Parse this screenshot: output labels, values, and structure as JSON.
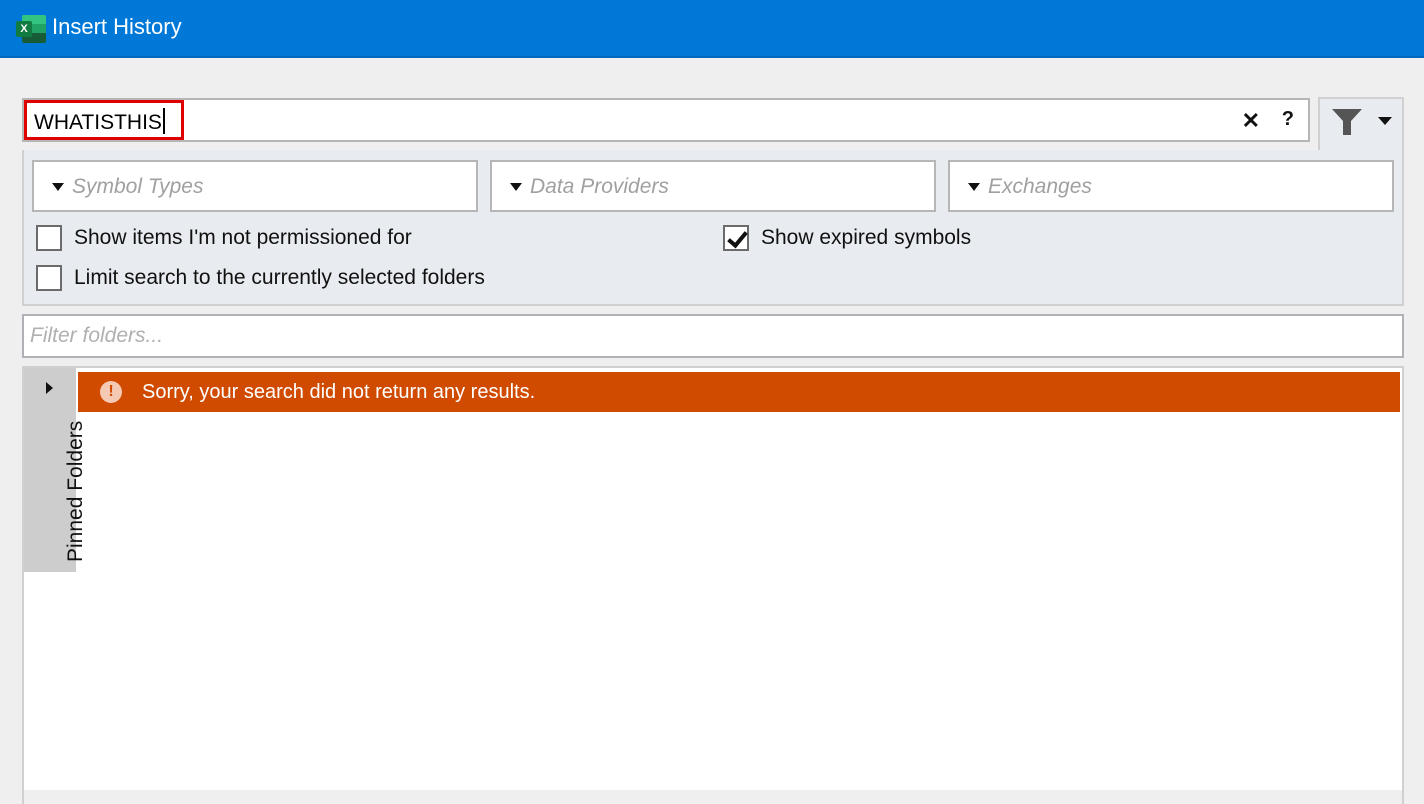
{
  "window": {
    "title": "Insert History",
    "app_icon": "excel-icon"
  },
  "search": {
    "value": "WHATISTHIS",
    "clear_label": "✕",
    "help_label": "?"
  },
  "filter_toggle": {
    "icon": "funnel-icon"
  },
  "filters": {
    "dropdowns": [
      {
        "label": "Symbol Types"
      },
      {
        "label": "Data Providers"
      },
      {
        "label": "Exchanges"
      }
    ],
    "checkboxes": [
      {
        "label": "Show items I'm not permissioned for",
        "checked": false
      },
      {
        "label": "Limit search to the currently selected folders",
        "checked": false
      },
      {
        "label": "Show expired symbols",
        "checked": true
      }
    ]
  },
  "folder_filter": {
    "placeholder": "Filter folders...",
    "value": ""
  },
  "pinned_folders": {
    "label": "Pinned Folders"
  },
  "results": {
    "error_icon": "!",
    "error_message": "Sorry, your search did not return any results."
  },
  "colors": {
    "titlebar": "#0078d7",
    "error_banner": "#d04b00",
    "search_highlight": "#e00000"
  }
}
